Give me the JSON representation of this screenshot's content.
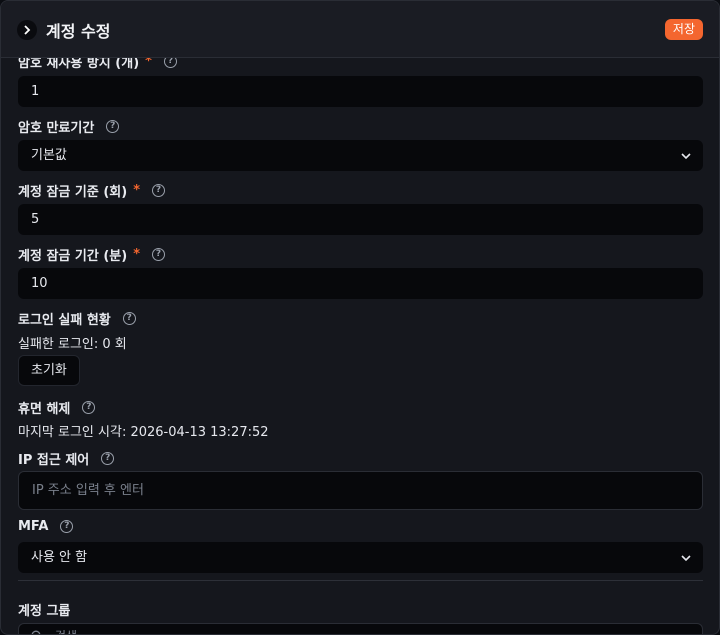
{
  "header": {
    "title": "계정 수정",
    "save_label": "저장"
  },
  "fields": {
    "password_reuse": {
      "label": "암호 재사용 방지 (개)",
      "value": "1"
    },
    "password_expiry": {
      "label": "암호 만료기간",
      "value": "기본값"
    },
    "lock_threshold": {
      "label": "계정 잠금 기준 (회)",
      "value": "5"
    },
    "lock_duration": {
      "label": "계정 잠금 기간 (분)",
      "value": "10"
    },
    "login_failure": {
      "label": "로그인 실패 현황",
      "status": "실패한 로그인: 0 회",
      "reset_label": "초기화"
    },
    "dormant": {
      "label": "휴면 해제",
      "last_login": "마지막 로그인 시각: 2026-04-13 13:27:52"
    },
    "ip_access": {
      "label": "IP 접근 제어",
      "placeholder": "IP 주소 입력 후 엔터"
    },
    "mfa": {
      "label": "MFA",
      "value": "사용 안 함"
    },
    "groups": {
      "label": "계정 그룹",
      "search_placeholder": "검색"
    }
  },
  "icons": {
    "back": "chevron-right-icon",
    "help": "help-circle-icon",
    "dropdown": "chevron-down-icon",
    "search": "search-icon"
  },
  "colors": {
    "accent": "#f4662f",
    "required": "#f4662f"
  }
}
